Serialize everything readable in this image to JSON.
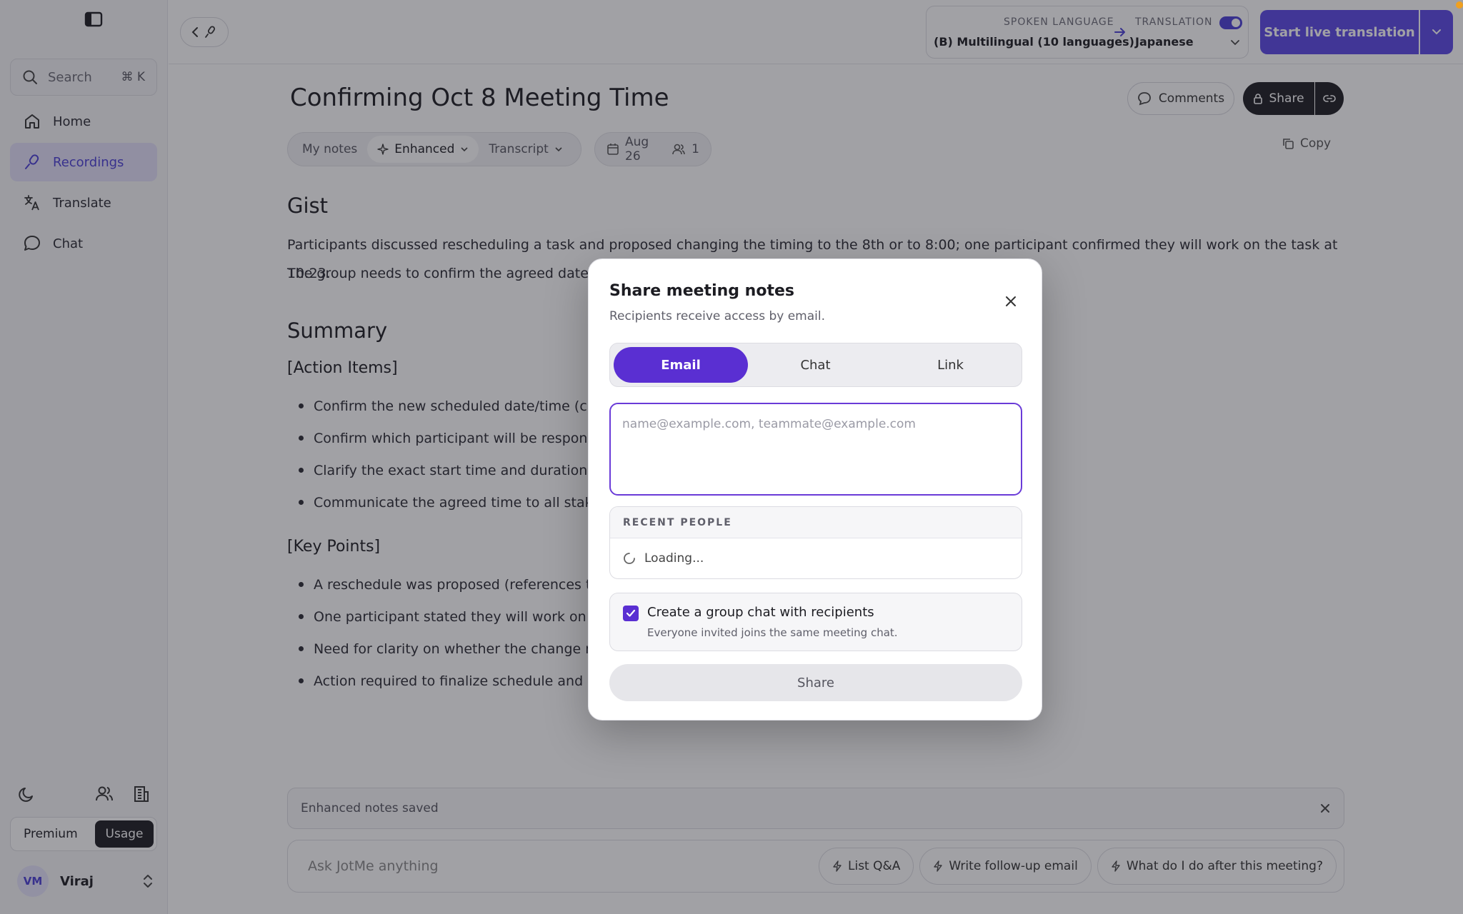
{
  "sidebar": {
    "search": {
      "label": "Search",
      "shortcut": "⌘ K"
    },
    "nav": [
      {
        "label": "Home",
        "icon": "home-icon"
      },
      {
        "label": "Recordings",
        "icon": "microphone-icon",
        "active": true
      },
      {
        "label": "Translate",
        "icon": "translate-icon"
      },
      {
        "label": "Chat",
        "icon": "chat-bubble-icon"
      }
    ],
    "plan": {
      "premium": "Premium",
      "usage": "Usage"
    },
    "user": {
      "initials": "VM",
      "name": "Viraj"
    }
  },
  "topbar": {
    "spoken_caption": "SPOKEN LANGUAGE",
    "spoken_value": "(B) Multilingual (10 languages)",
    "translation_caption": "TRANSLATION",
    "translation_value": "Japanese",
    "translation_enabled": true,
    "start_button": "Start live translation"
  },
  "doc": {
    "title": "Confirming Oct 8 Meeting Time",
    "comments": "Comments",
    "share": "Share",
    "tabs": {
      "my_notes": "My notes",
      "enhanced": "Enhanced",
      "transcript": "Transcript"
    },
    "date": "Aug 26",
    "participants": "1",
    "copy": "Copy",
    "gist_heading": "Gist",
    "gist_line1": "Participants discussed rescheduling a task and proposed changing the timing to the 8th or to 8:00; one participant confirmed they will work on the task at 10:23.",
    "gist_line2": "The group needs to confirm the agreed date/",
    "summary_heading": "Summary",
    "action_items_heading": "[Action Items]",
    "action_items": [
      "Confirm the new scheduled date/time (cla",
      "Confirm which participant will be responsi",
      "Clarify the exact start time and duration (p",
      "Communicate the agreed time to all stake"
    ],
    "key_points_heading": "[Key Points]",
    "key_points": [
      "A reschedule was proposed (references to",
      "One participant stated they will work on th",
      "Need for clarity on whether the change re",
      "Action required to finalize schedule and re"
    ]
  },
  "toast": {
    "text": "Enhanced notes saved"
  },
  "ask": {
    "placeholder": "Ask JotMe anything",
    "chips": [
      "List Q&A",
      "Write follow-up email",
      "What do I do after this meeting?"
    ]
  },
  "modal": {
    "title": "Share meeting notes",
    "subtitle": "Recipients receive access by email.",
    "tabs": [
      "Email",
      "Chat",
      "Link"
    ],
    "selected_tab": "Email",
    "email_placeholder": "name@example.com, teammate@example.com",
    "recent_header": "RECENT PEOPLE",
    "loading": "Loading...",
    "group_chat_label": "Create a group chat with recipients",
    "group_chat_desc": "Everyone invited joins the same meeting chat.",
    "group_chat_checked": true,
    "share_button": "Share"
  },
  "colors": {
    "accent": "#5a2fd2",
    "primary": "#5b48e6",
    "active_nav_bg": "#e4e1fa"
  }
}
